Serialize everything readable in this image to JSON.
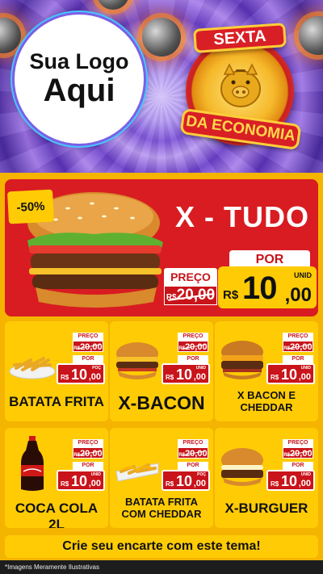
{
  "logo": {
    "line1": "Sua Logo",
    "line2": "Aqui"
  },
  "seal": {
    "top": "SEXTA",
    "bottom": "DA ECONOMIA"
  },
  "hero": {
    "discount": "-50%",
    "title": "X - TUDO",
    "preco_label": "PREÇO",
    "old_currency": "R$",
    "old_value": "20,00",
    "por_label": "POR",
    "currency": "R$",
    "price_int": "10",
    "price_cents": ",00",
    "unit": "UNID"
  },
  "products": [
    {
      "name": "BATATA FRITA",
      "preco_label": "PREÇO",
      "old_currency": "R$",
      "old_value": "20,00",
      "por_label": "POR",
      "currency": "R$",
      "price_int": "10",
      "price_cents": ",00",
      "unit": "POÇ"
    },
    {
      "name": "X-BACON",
      "preco_label": "PREÇO",
      "old_currency": "R$",
      "old_value": "20,00",
      "por_label": "POR",
      "currency": "R$",
      "price_int": "10",
      "price_cents": ",00",
      "unit": "UNID"
    },
    {
      "name": "X BACON E CHEDDAR",
      "preco_label": "PREÇO",
      "old_currency": "R$",
      "old_value": "20,00",
      "por_label": "POR",
      "currency": "R$",
      "price_int": "10",
      "price_cents": ",00",
      "unit": "UNID"
    },
    {
      "name": "COCA COLA 2L",
      "preco_label": "PREÇO",
      "old_currency": "R$",
      "old_value": "20,00",
      "por_label": "POR",
      "currency": "R$",
      "price_int": "10",
      "price_cents": ",00",
      "unit": "UNID"
    },
    {
      "name": "BATATA FRITA COM CHEDDAR",
      "preco_label": "PREÇO",
      "old_currency": "R$",
      "old_value": "20,00",
      "por_label": "POR",
      "currency": "R$",
      "price_int": "10",
      "price_cents": ",00",
      "unit": "POÇ"
    },
    {
      "name": "X-BURGUER",
      "preco_label": "PREÇO",
      "old_currency": "R$",
      "old_value": "20,00",
      "por_label": "POR",
      "currency": "R$",
      "price_int": "10",
      "price_cents": ",00",
      "unit": "UNID"
    }
  ],
  "banner": "Crie seu encarte com este tema!",
  "footer": "*Imagens Meramente Ilustrativas",
  "colors": {
    "red": "#d81c22",
    "yellow": "#ffcb05",
    "purple": "#6a3fc9"
  }
}
